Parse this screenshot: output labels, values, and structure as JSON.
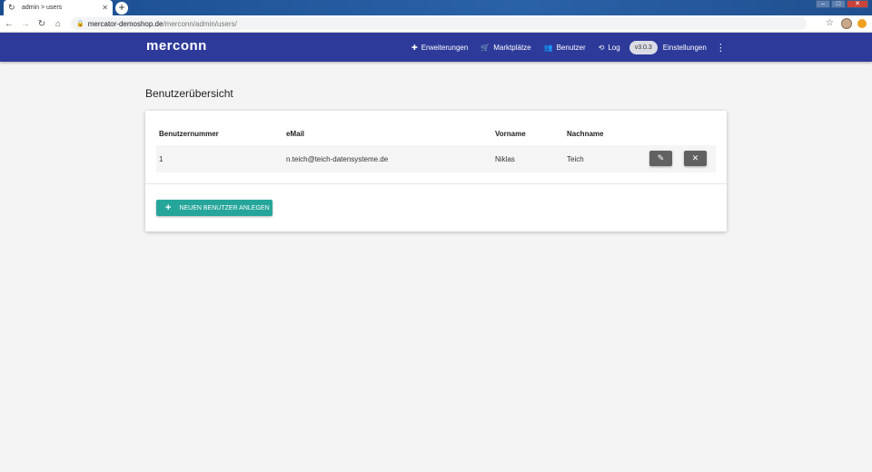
{
  "browser": {
    "tab_title": "admin > users",
    "url_host": "mercator-demoshop.de",
    "url_path": "/merconn/admin/users/",
    "icons": [
      "tab-favicon-icon",
      "close-icon",
      "plus-icon",
      "back-icon",
      "forward-icon",
      "reload-icon",
      "home-icon",
      "lock-icon",
      "star-icon",
      "profile-avatar-icon",
      "extension-icon",
      "minimize-icon",
      "maximize-icon",
      "window-close-icon"
    ]
  },
  "header": {
    "logo": "merconn",
    "nav": [
      {
        "label": "Erweiterungen",
        "icon": "puzzle-icon"
      },
      {
        "label": "Marktplätze",
        "icon": "cart-icon"
      },
      {
        "label": "Benutzer",
        "icon": "people-icon"
      },
      {
        "label": "Log",
        "icon": "history-icon"
      }
    ],
    "version": "v3.0.3",
    "settings": "Einstellungen",
    "accent_color": "#2d3a9a"
  },
  "main": {
    "title": "Benutzerübersicht",
    "table": {
      "columns": [
        "Benutzernummer",
        "eMail",
        "Vorname",
        "Nachname"
      ],
      "rows": [
        {
          "number": "1",
          "email": "n.teich@teich-datensysteme.de",
          "firstname": "Niklas",
          "lastname": "Teich"
        }
      ]
    },
    "add_button": "NEUEN BENUTZER ANLEGEN",
    "add_button_color": "#26a69a"
  }
}
